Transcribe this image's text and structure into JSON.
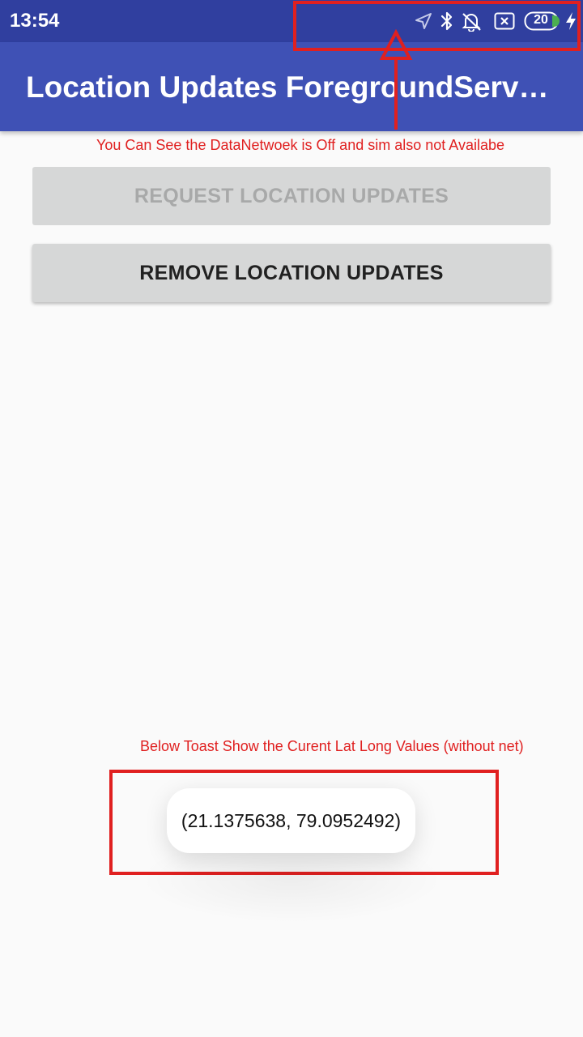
{
  "status_bar": {
    "time": "13:54",
    "battery_level": "20",
    "icons": [
      "location-arrow-icon",
      "bluetooth-icon",
      "alarm-off-icon",
      "no-sim-icon",
      "battery-icon",
      "charging-bolt-icon"
    ],
    "background_color": "#303f9f"
  },
  "app_bar": {
    "title": "Location Updates ForegroundServ…",
    "background_color": "#3f51b5"
  },
  "annotations": {
    "top_note": "You Can See the DataNetwoek is Off and sim also not Availabe",
    "bottom_note": "Below Toast Show the Curent Lat Long Values   (without net)",
    "color": "#e02020"
  },
  "buttons": {
    "request_label": "REQUEST LOCATION UPDATES",
    "remove_label": "REMOVE LOCATION UPDATES"
  },
  "toast": {
    "text": "(21.1375638, 79.0952492)"
  }
}
